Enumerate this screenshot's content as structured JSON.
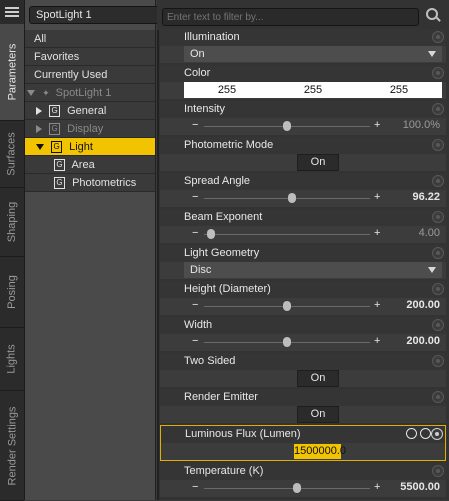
{
  "tabs": [
    {
      "label": "Parameters"
    },
    {
      "label": "Surfaces"
    },
    {
      "label": "Shaping"
    },
    {
      "label": "Posing"
    },
    {
      "label": "Lights"
    },
    {
      "label": "Render Settings"
    }
  ],
  "node_selector": "SpotLight 1",
  "tree": {
    "all": "All",
    "favorites": "Favorites",
    "currently_used": "Currently Used",
    "root": "SpotLight 1",
    "general": "General",
    "display": "Display",
    "light": "Light",
    "area": "Area",
    "photometrics": "Photometrics",
    "group_glyph": "G"
  },
  "filter_placeholder": "Enter text to filter by...",
  "props": {
    "illumination": {
      "label": "Illumination",
      "value": "On"
    },
    "color": {
      "label": "Color",
      "r": "255",
      "g": "255",
      "b": "255"
    },
    "intensity": {
      "label": "Intensity",
      "value": "100.0%",
      "level": 0.5
    },
    "photometric_mode": {
      "label": "Photometric Mode",
      "value": "On"
    },
    "spread_angle": {
      "label": "Spread Angle",
      "value": "96.22",
      "level": 0.53
    },
    "beam_exponent": {
      "label": "Beam Exponent",
      "value": "4.00",
      "level": 0.04
    },
    "light_geometry": {
      "label": "Light Geometry",
      "value": "Disc"
    },
    "height": {
      "label": "Height (Diameter)",
      "value": "200.00",
      "level": 0.5
    },
    "width": {
      "label": "Width",
      "value": "200.00",
      "level": 0.5
    },
    "two_sided": {
      "label": "Two Sided",
      "value": "On"
    },
    "render_emitter": {
      "label": "Render Emitter",
      "value": "On"
    },
    "luminous_flux": {
      "label": "Luminous Flux (Lumen)",
      "value": "1500000.0"
    },
    "temperature": {
      "label": "Temperature (K)",
      "value": "5500.00",
      "level": 0.56
    }
  },
  "colors": {
    "accent": "#f2c300",
    "panel": "#333333"
  }
}
